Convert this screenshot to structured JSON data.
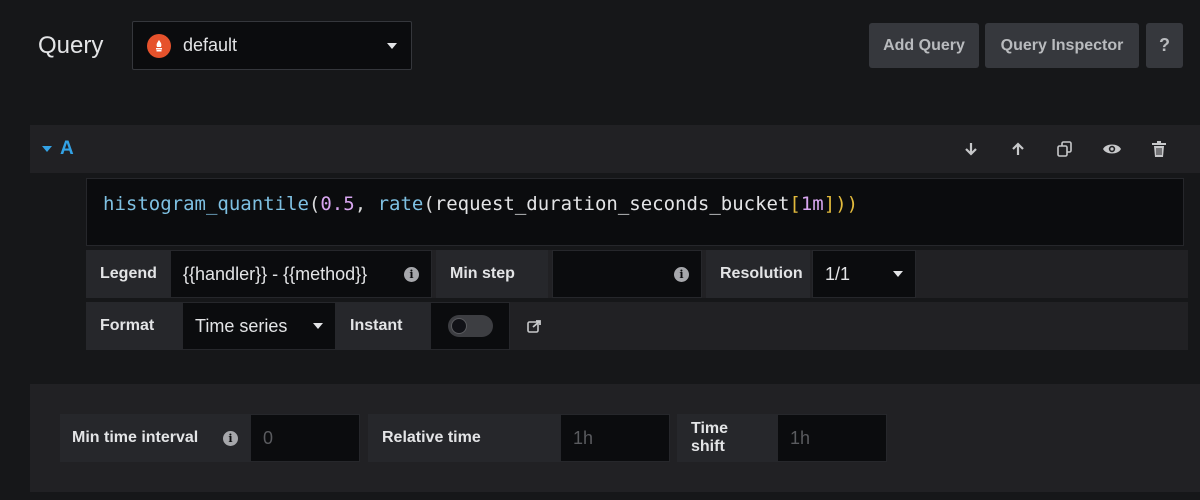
{
  "header": {
    "title": "Query",
    "datasource": "default",
    "add_query": "Add Query",
    "query_inspector": "Query Inspector",
    "help": "?"
  },
  "query": {
    "ref_id": "A",
    "expr": {
      "fn1": "histogram_quantile",
      "open1": "(",
      "num": "0.5",
      "sep": ", ",
      "fn2": "rate",
      "open2": "(",
      "metric": "request_duration_seconds_bucket",
      "lb": "[",
      "dur": "1m",
      "rb": "]",
      "close": "))"
    },
    "actions": [
      "arrow-down-icon",
      "arrow-up-icon",
      "copy-icon",
      "eye-icon",
      "trash-icon"
    ]
  },
  "options": {
    "legend_label": "Legend",
    "legend_value": "{{handler}} - {{method}}",
    "min_step_label": "Min step",
    "min_step_value": "",
    "resolution_label": "Resolution",
    "resolution_value": "1/1",
    "format_label": "Format",
    "format_value": "Time series",
    "instant_label": "Instant",
    "instant_on": false
  },
  "panel_options": {
    "min_interval_label": "Min time interval",
    "min_interval_placeholder": "0",
    "relative_time_label": "Relative time",
    "relative_time_placeholder": "1h",
    "time_shift_label": "Time shift",
    "time_shift_placeholder": "1h"
  }
}
